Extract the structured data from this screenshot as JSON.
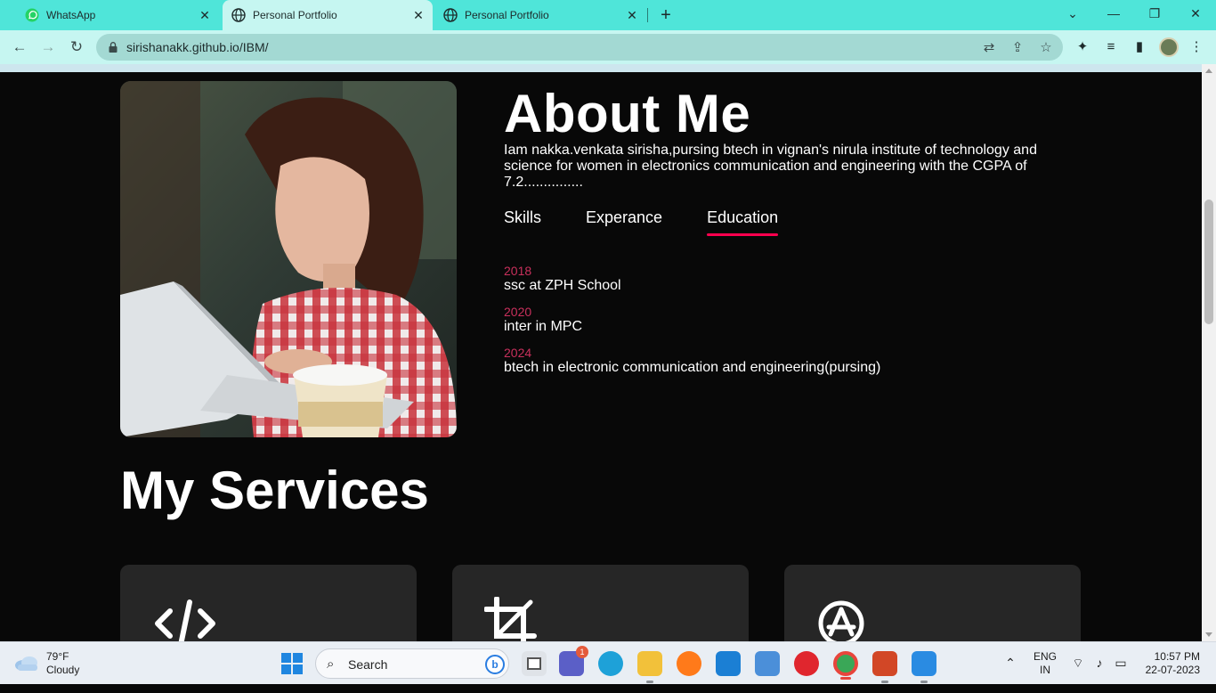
{
  "browser": {
    "tabs": [
      {
        "title": "WhatsApp",
        "active": false
      },
      {
        "title": "Personal Portfolio",
        "active": true
      },
      {
        "title": "Personal Portfolio",
        "active": false
      }
    ],
    "url": "sirishanakk.github.io/IBM/"
  },
  "about": {
    "title": "About Me",
    "description": "Iam nakka.venkata sirisha,pursing btech in vignan's nirula institute of technology and science for women in electronics communication and engineering with the CGPA of 7.2...............",
    "tabs": [
      "Skills",
      "Experance",
      "Education"
    ],
    "active_tab": "Education",
    "education": [
      {
        "year": "2018",
        "desc": "ssc at ZPH School"
      },
      {
        "year": "2020",
        "desc": "inter in MPC"
      },
      {
        "year": "2024",
        "desc": "btech in electronic communication and engineering(pursing)"
      }
    ]
  },
  "services": {
    "title": "My Services",
    "cards": [
      {
        "icon": "code-icon"
      },
      {
        "icon": "crop-icon"
      },
      {
        "icon": "app-store-icon"
      }
    ]
  },
  "taskbar": {
    "weather_temp": "79°F",
    "weather_desc": "Cloudy",
    "search_label": "Search",
    "chat_badge": "1",
    "lang_top": "ENG",
    "lang_bottom": "IN",
    "time": "10:57 PM",
    "date": "22-07-2023"
  },
  "colors": {
    "accent": "#ff004f",
    "year": "#c8305c",
    "tabbar": "#4fe5d9",
    "toolbar": "#c6f6f1",
    "page_bg": "#080808",
    "card_bg": "#262626"
  }
}
